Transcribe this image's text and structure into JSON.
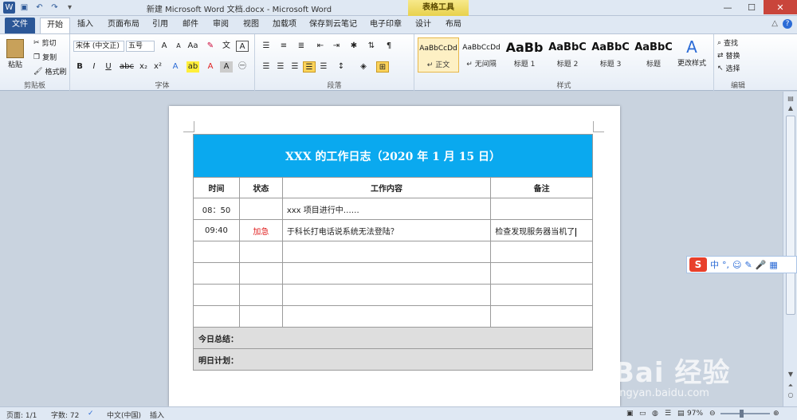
{
  "window": {
    "title": "新建 Microsoft Word 文档.docx - Microsoft Word",
    "contextual_tab": "表格工具",
    "minimize": "—",
    "maximize": "☐",
    "close": "✕"
  },
  "tabs": [
    "文件",
    "开始",
    "插入",
    "页面布局",
    "引用",
    "邮件",
    "审阅",
    "视图",
    "加载项",
    "保存到云笔记",
    "电子印章",
    "设计",
    "布局"
  ],
  "ribbon": {
    "clipboard": {
      "paste": "粘贴",
      "cut": "剪切",
      "copy": "复制",
      "format_painter": "格式刷",
      "label": "剪贴板"
    },
    "font": {
      "font_name": "宋体 (中文正)",
      "font_size": "五号",
      "label": "字体"
    },
    "paragraph": {
      "label": "段落"
    },
    "styles": {
      "label": "样式",
      "items": [
        {
          "sample": "AaBbCcDd",
          "name": "↵ 正文"
        },
        {
          "sample": "AaBbCcDd",
          "name": "↵ 无间隔"
        },
        {
          "sample": "AaBb",
          "name": "标题 1"
        },
        {
          "sample": "AaBbC",
          "name": "标题 2"
        },
        {
          "sample": "AaBbC",
          "name": "标题 3"
        },
        {
          "sample": "AaBbC",
          "name": "标题"
        }
      ],
      "change_styles": "更改样式"
    },
    "editing": {
      "find": "查找",
      "replace": "替换",
      "select": "选择",
      "label": "编辑"
    }
  },
  "document": {
    "table_title": "XXX 的工作日志（2020 年 1 月 15 日）",
    "columns": [
      "时间",
      "状态",
      "工作内容",
      "备注"
    ],
    "rows": [
      [
        "08：50",
        "",
        "xxx 项目进行中……",
        ""
      ],
      [
        "09:40",
        "加急",
        "于科长打电话说系统无法登陆？",
        "检查发现服务器当机了"
      ],
      [
        "",
        "",
        "",
        ""
      ],
      [
        "",
        "",
        "",
        ""
      ],
      [
        "",
        "",
        "",
        ""
      ],
      [
        "",
        "",
        "",
        ""
      ]
    ],
    "summary_today": "今日总结：",
    "plan_tomorrow": "明日计划："
  },
  "status": {
    "page": "页面: 1/1",
    "words": "字数: 72",
    "language": "中文(中国)",
    "mode": "插入",
    "zoom": "97%"
  },
  "colors": {
    "header_fill": "#0aa9ef",
    "urgent_text": "#e02020",
    "summary_fill": "#dedede",
    "file_tab": "#2b5797"
  },
  "ime": {
    "mode": "中"
  },
  "watermark": {
    "text": "Bai 经验",
    "url": "jingyan.baidu.com"
  }
}
